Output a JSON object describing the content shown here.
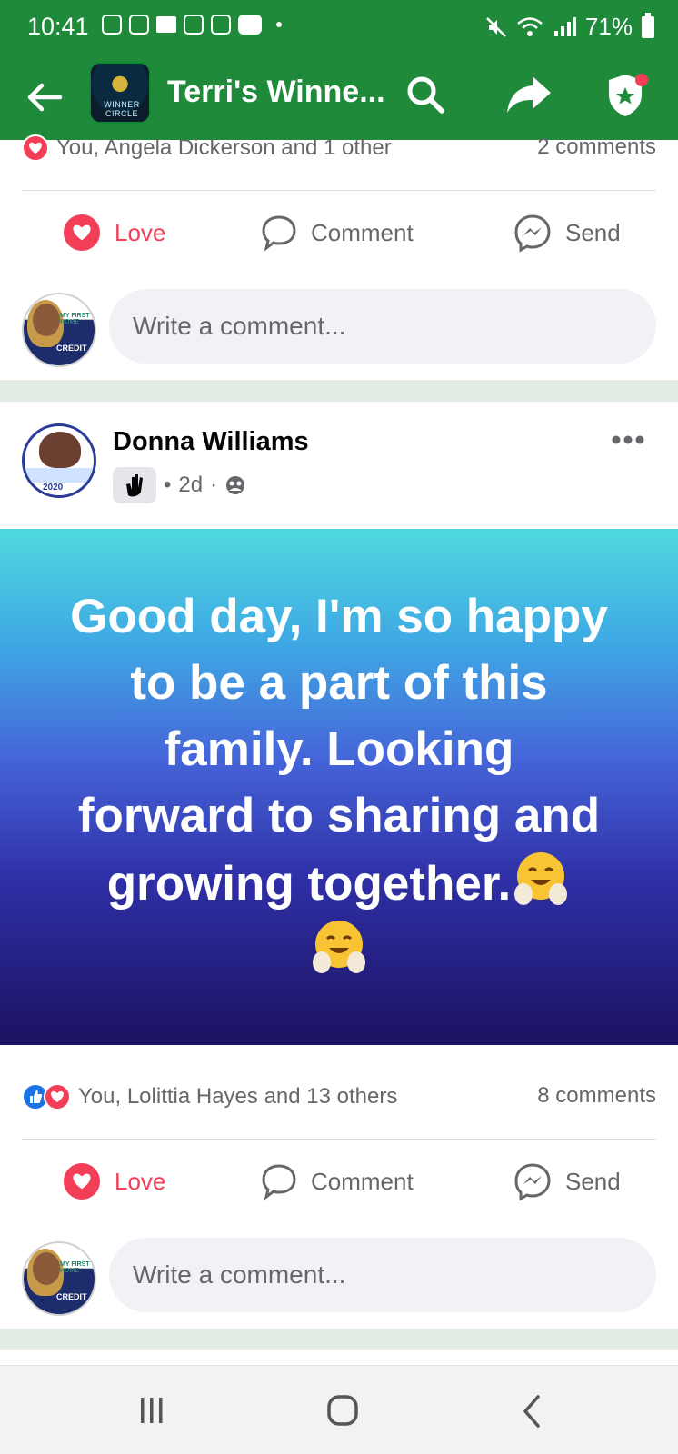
{
  "status_bar": {
    "time": "10:41",
    "battery": "71%"
  },
  "app_bar": {
    "title": "Terri's Winne...",
    "group_logo_text": "WINNER CIRCLE"
  },
  "top_post": {
    "reactions_text": "You, Angela Dickerson and 1 other",
    "comments_count": "2 comments",
    "actions": {
      "love": "Love",
      "comment": "Comment",
      "send": "Send"
    },
    "comment_placeholder": "Write a comment..."
  },
  "post": {
    "author": "Donna Williams",
    "time": "2d",
    "text_lines": [
      "Good day, I'm so happy",
      "to be a part of this",
      "family. Looking",
      "forward to sharing and",
      "growing together."
    ],
    "emoji_name": "hugging-face",
    "reactions_text": "You, Lolittia Hayes and 13 others",
    "comments_count": "8 comments",
    "actions": {
      "love": "Love",
      "comment": "Comment",
      "send": "Send"
    },
    "comment_placeholder": "Write a comment..."
  },
  "colors": {
    "brand_green": "#1f8a3a",
    "love_red": "#f33e58",
    "like_blue": "#1b74e4",
    "muted_text": "#65676b"
  }
}
